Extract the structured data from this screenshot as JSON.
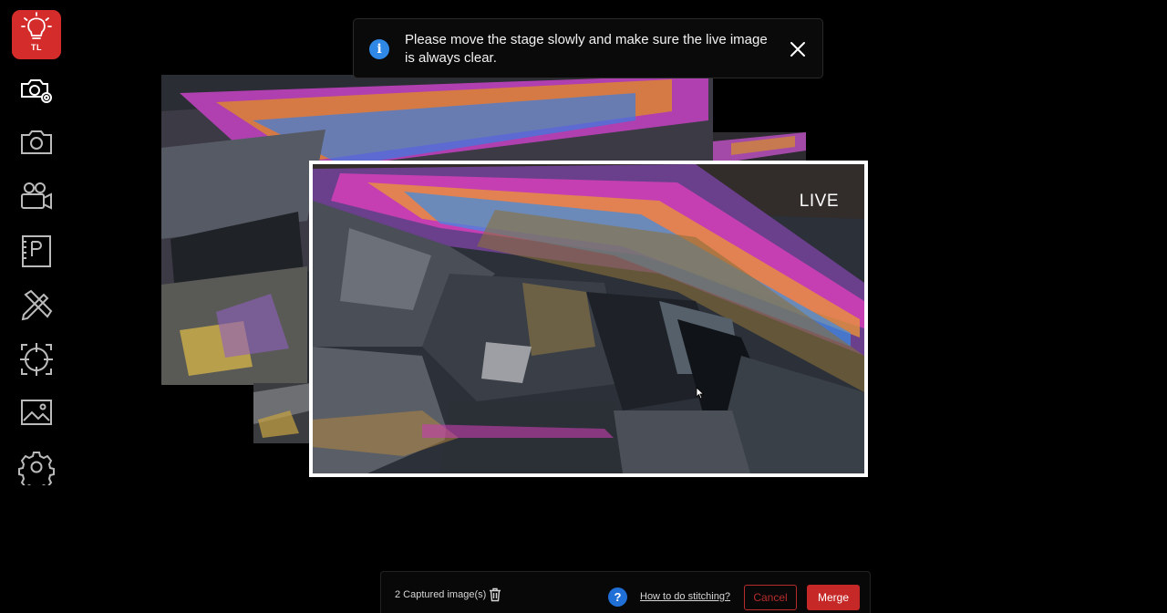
{
  "sidebar": {
    "light_label": "TL",
    "items": [
      {
        "name": "camera-settings-icon"
      },
      {
        "name": "capture-photo-icon"
      },
      {
        "name": "record-video-icon"
      },
      {
        "name": "measure-icon"
      },
      {
        "name": "annotate-tools-icon"
      },
      {
        "name": "focus-target-icon"
      },
      {
        "name": "gallery-icon"
      },
      {
        "name": "settings-icon"
      }
    ]
  },
  "toast": {
    "message": "Please move the stage slowly and make sure the live image is always clear."
  },
  "live": {
    "label": "LIVE"
  },
  "bottom_bar": {
    "captured_count_text": "2 Captured image(s)",
    "help_symbol": "?",
    "howto_link": "How to do stitching?",
    "cancel_label": "Cancel",
    "merge_label": "Merge"
  },
  "colors": {
    "accent_red": "#d42b2b",
    "info_blue": "#2f88e6",
    "help_blue": "#1f6fd6"
  }
}
